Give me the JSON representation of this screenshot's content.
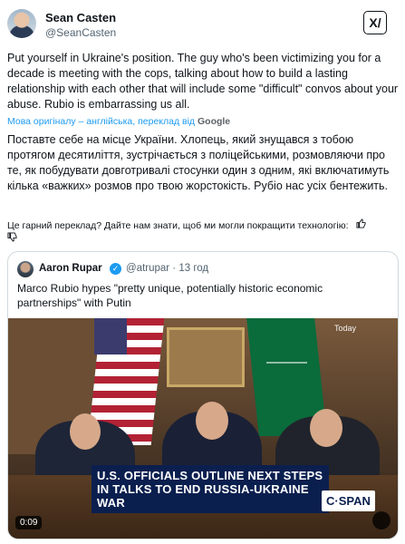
{
  "tweet": {
    "author_name": "Sean Casten",
    "author_handle": "@SeanCasten",
    "text": "Put yourself in Ukraine's position.  The guy who's been victimizing you for a decade is meeting with the cops, talking about how to build a lasting relationship with each other that will include some \"difficult\" convos about your abuse.  Rubio is embarrassing us all.",
    "translation_note": "Мова оригіналу – англійська, переклад від",
    "translation_provider": "Google",
    "translated_text": "Поставте себе на місце України. Хлопець, який знущався з тобою протягом десятиліття, зустрічається з поліцейськими, розмовляючи про те, як побудувати довготривалі стосунки один з одним, які включатимуть кілька «важких» розмов про твою жорстокість. Рубіо нас усіх бентежить.",
    "feedback_prompt": "Це гарний переклад? Дайте нам знати, щоб ми могли покращити технологію:"
  },
  "quote": {
    "author_name": "Aaron Rupar",
    "author_handle": "@atrupar · 13 год",
    "text": "Marco Rubio hypes \"pretty unique, potentially historic economic partnerships\" with Putin",
    "video": {
      "badge": "Today",
      "chyron": "U.S. OFFICIALS OUTLINE NEXT STEPS IN TALKS TO END RUSSIA-UKRAINE WAR",
      "network": "C·SPAN",
      "duration": "0:09"
    }
  },
  "icons": {
    "translate": "x-translate-icon",
    "verified": "verified-badge-icon",
    "thumbs_up": "thumbs-up-icon",
    "thumbs_down": "thumbs-down-icon"
  },
  "colors": {
    "link": "#1d9bf0",
    "text": "#0f1419",
    "muted": "#536471",
    "chyron_bg": "#0b1f4f"
  }
}
